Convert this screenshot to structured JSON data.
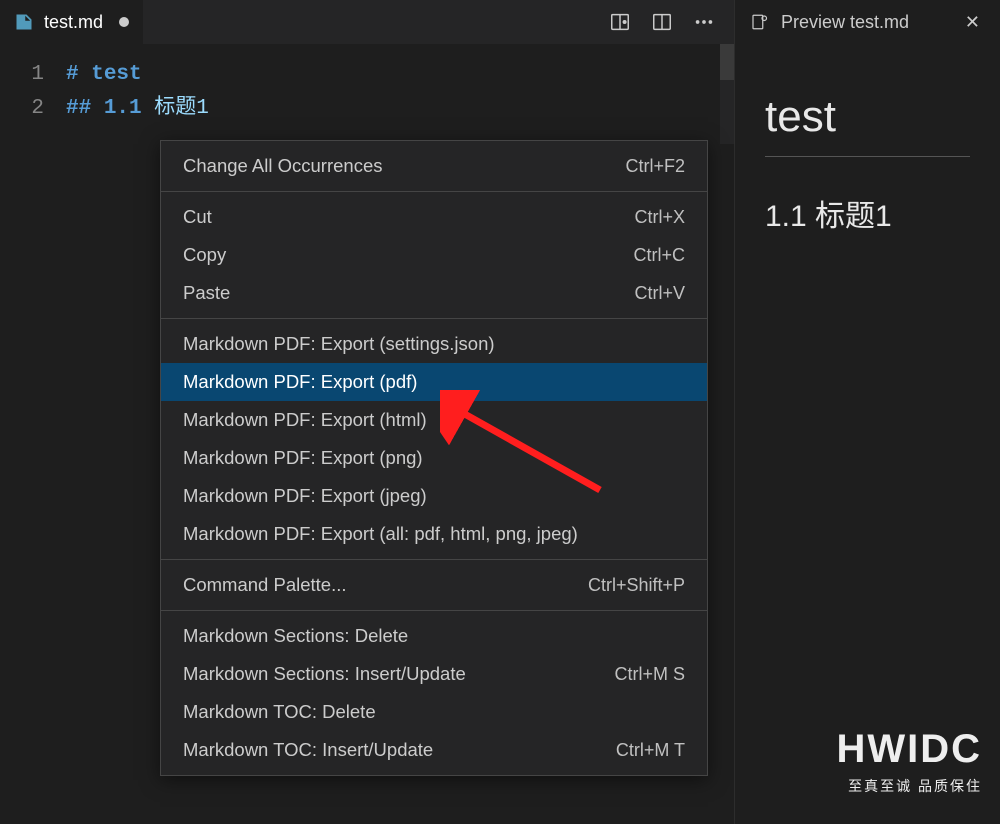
{
  "editor": {
    "tab": {
      "filename": "test.md",
      "modified": true
    },
    "lines": [
      {
        "num": "1",
        "md_prefix": "#",
        "space": " ",
        "text_en": "test",
        "text_cjk": ""
      },
      {
        "num": "2",
        "md_prefix": "##",
        "space": " ",
        "text_en": "1.1 ",
        "text_cjk": "标题1"
      }
    ]
  },
  "preview": {
    "tab_label": "Preview test.md",
    "h1": "test",
    "h2": "1.1 标题1"
  },
  "context_menu": {
    "groups": [
      [
        {
          "label": "Change All Occurrences",
          "shortcut": "Ctrl+F2"
        }
      ],
      [
        {
          "label": "Cut",
          "shortcut": "Ctrl+X"
        },
        {
          "label": "Copy",
          "shortcut": "Ctrl+C"
        },
        {
          "label": "Paste",
          "shortcut": "Ctrl+V"
        }
      ],
      [
        {
          "label": "Markdown PDF: Export (settings.json)",
          "shortcut": ""
        },
        {
          "label": "Markdown PDF: Export (pdf)",
          "shortcut": "",
          "highlighted": true
        },
        {
          "label": "Markdown PDF: Export (html)",
          "shortcut": ""
        },
        {
          "label": "Markdown PDF: Export (png)",
          "shortcut": ""
        },
        {
          "label": "Markdown PDF: Export (jpeg)",
          "shortcut": ""
        },
        {
          "label": "Markdown PDF: Export (all: pdf, html, png, jpeg)",
          "shortcut": ""
        }
      ],
      [
        {
          "label": "Command Palette...",
          "shortcut": "Ctrl+Shift+P"
        }
      ],
      [
        {
          "label": "Markdown Sections: Delete",
          "shortcut": ""
        },
        {
          "label": "Markdown Sections: Insert/Update",
          "shortcut": "Ctrl+M S"
        },
        {
          "label": "Markdown TOC: Delete",
          "shortcut": ""
        },
        {
          "label": "Markdown TOC: Insert/Update",
          "shortcut": "Ctrl+M T"
        }
      ]
    ]
  },
  "watermark": {
    "big": "HWIDC",
    "small": "至真至诚 品质保住"
  }
}
